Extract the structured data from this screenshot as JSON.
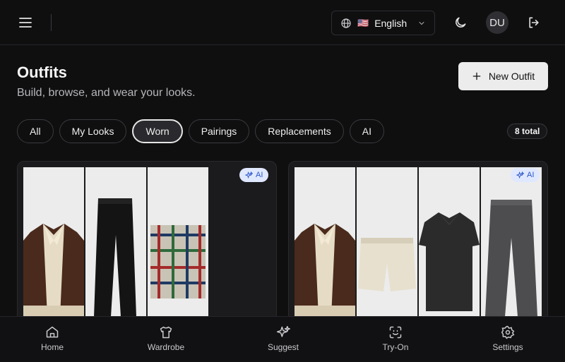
{
  "header": {
    "language": {
      "flag": "🇺🇸",
      "label": "English"
    },
    "avatar_initials": "DU"
  },
  "page": {
    "title": "Outfits",
    "subtitle": "Build, browse, and wear your looks.",
    "new_button_label": "New Outfit"
  },
  "filters": {
    "tabs": [
      "All",
      "My Looks",
      "Worn",
      "Pairings",
      "Replacements",
      "AI"
    ],
    "active": "Worn",
    "total": "8 total"
  },
  "cards": [
    {
      "badge": "AI",
      "items": [
        "brown-cream-knit-shirt",
        "black-jeans",
        "plaid-scarf"
      ]
    },
    {
      "badge": "AI",
      "items": [
        "brown-cream-knit-shirt",
        "cream-shorts",
        "black-polo-shirt",
        "grey-jeans"
      ]
    }
  ],
  "bottom_nav": [
    {
      "label": "Home",
      "icon": "home-icon"
    },
    {
      "label": "Wardrobe",
      "icon": "shirt-icon"
    },
    {
      "label": "Suggest",
      "icon": "sparkles-icon"
    },
    {
      "label": "Try-On",
      "icon": "scan-face-icon"
    },
    {
      "label": "Settings",
      "icon": "gear-icon"
    }
  ],
  "colors": {
    "background": "#0f0f10",
    "ai_badge_bg": "#dfe8ff",
    "ai_badge_text": "#2b55c8",
    "primary_button": "#ececec"
  }
}
